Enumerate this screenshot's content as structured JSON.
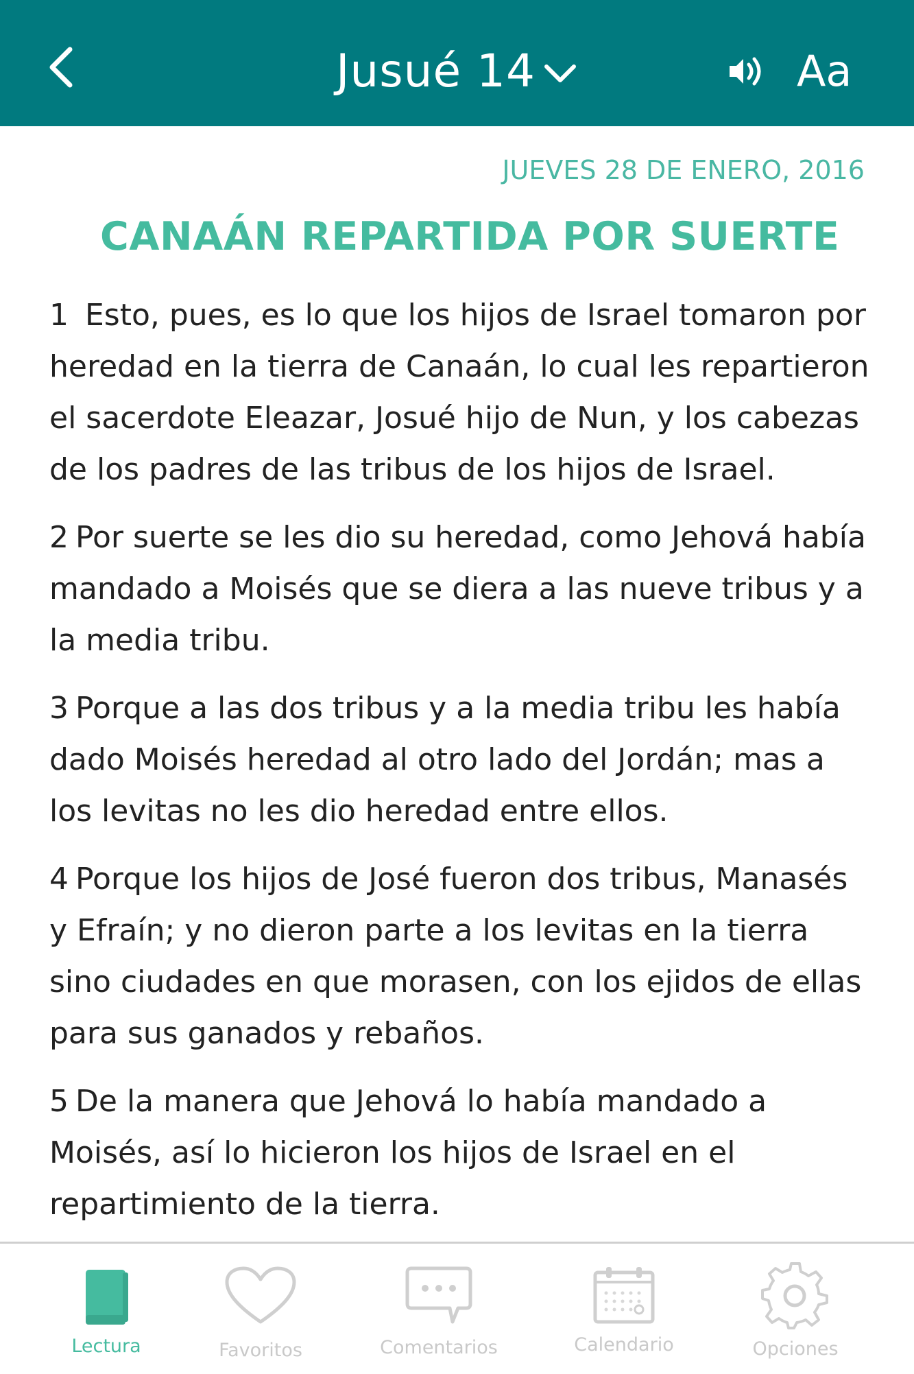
{
  "header": {
    "chapter_title": "Jusué 14",
    "font_button_label": "Aa",
    "bar_color": "#017a7f"
  },
  "reading": {
    "date": "JUEVES 28 DE ENERO, 2016",
    "section_title": "CANAÁN REPARTIDA POR SUERTE",
    "accent_color": "#45bb9f",
    "verses": [
      {
        "num": "1",
        "text": "Esto, pues, es lo que los hijos de Israel tomaron por heredad en la tierra de Canaán, lo cual les repartieron el sacerdote Eleazar, Josué hijo de Nun, y los cabezas de los padres de las tribus de los hijos de Israel."
      },
      {
        "num": "2",
        "text": "Por suerte se les dio su heredad, como Jehová había mandado a Moisés que se diera a las nueve tribus y a la media tribu."
      },
      {
        "num": "3",
        "text": "Porque a las dos tribus y a la media tribu les había dado Moisés heredad al otro lado del Jordán; mas a los levitas no les dio heredad entre ellos."
      },
      {
        "num": "4",
        "text": "Porque los hijos de José fueron dos tribus, Manasés y Efraín; y no dieron parte a los levitas en la tierra sino ciudades en que morasen, con los ejidos de ellas para sus ganados y rebaños."
      },
      {
        "num": "5",
        "text": "De la manera que Jehová lo había mandado a Moisés, así lo hicieron los hijos de Israel en el repartimiento de la tierra."
      }
    ]
  },
  "tabbar": {
    "active_tab": "Lectura",
    "tabs": [
      {
        "label": "Lectura",
        "icon": "book-icon"
      },
      {
        "label": "Favoritos",
        "icon": "heart-icon"
      },
      {
        "label": "Comentarios",
        "icon": "chat-bubble-icon"
      },
      {
        "label": "Calendario",
        "icon": "calendar-icon"
      },
      {
        "label": "Opciones",
        "icon": "gear-icon"
      }
    ]
  }
}
